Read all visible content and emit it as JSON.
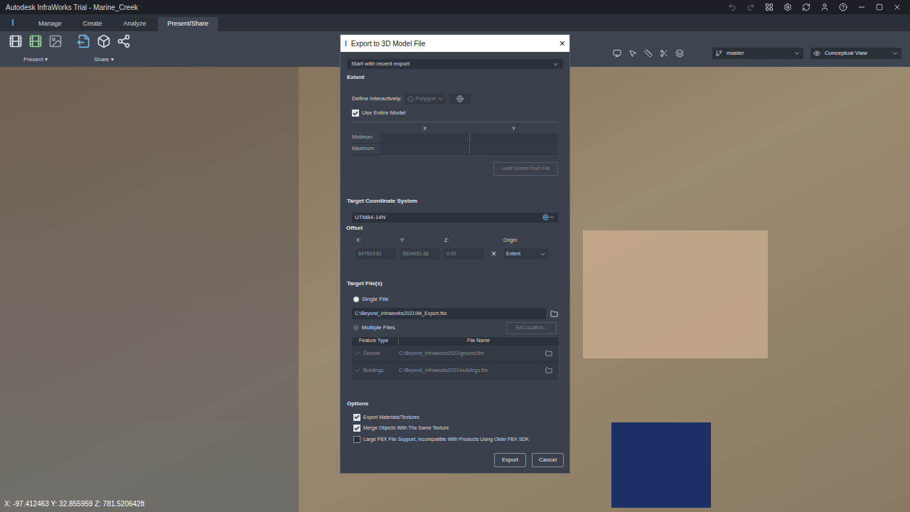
{
  "window": {
    "title": "Autodesk InfraWorks Trial - Marine_Creek",
    "logo": "I"
  },
  "ribbon": {
    "tabs": [
      {
        "label": "Manage",
        "selected": false
      },
      {
        "label": "Create",
        "selected": false
      },
      {
        "label": "Analyze",
        "selected": false
      },
      {
        "label": "Present/Share",
        "selected": true
      }
    ],
    "groups": [
      {
        "label": "Present",
        "arrow": "▾"
      },
      {
        "label": "Share",
        "arrow": "▾"
      }
    ],
    "branch": "master",
    "view": "Conceptual View"
  },
  "dialog": {
    "title": "Export to 3D Model File",
    "close": "×",
    "preset": "Start with recent export",
    "extent": {
      "heading": "Extent",
      "define_label": "Define Interactively:",
      "polygon": "Polygon",
      "polygon_disabled": true,
      "use_entire_model": {
        "label": "Use Entire Model",
        "checked": true
      },
      "columns": [
        "X",
        "Y"
      ],
      "rows": [
        "Minimum:",
        "Maximum:"
      ],
      "load_button": "Load Extent From File",
      "load_disabled": true
    },
    "coordinate_system": {
      "heading": "Target Coordinate System",
      "value": "UTM84-14N"
    },
    "offset": {
      "heading": "Offset",
      "fields": [
        {
          "label": "X:",
          "value": "647819.81"
        },
        {
          "label": "Y:",
          "value": "3634951.68"
        },
        {
          "label": "Z:",
          "value": "0.00"
        }
      ],
      "clear": "×",
      "origin_label": "Origin:",
      "origin": "Extent"
    },
    "target": {
      "heading": "Target File(s)",
      "modes": [
        {
          "label": "Single File",
          "selected": true
        },
        {
          "label": "Multiple Files",
          "selected": false
        }
      ],
      "path": "C:\\Beyond_Infraworks2021\\IM_Export.fbx",
      "set_location": "Set Location...",
      "columns": [
        "Feature Type",
        "File Name"
      ],
      "rows": [
        {
          "type": "Ground",
          "file": "C:\\Beyond_Infraworks2021\\ground.fbx",
          "checked": true
        },
        {
          "type": "Buildings",
          "file": "C:\\Beyond_Infraworks2021\\buildings.fbx",
          "checked": true
        }
      ]
    },
    "options": {
      "heading": "Options",
      "items": [
        {
          "label": "Export Materials/Textures",
          "checked": true
        },
        {
          "label": "Merge Objects With The Same Texture",
          "checked": true
        },
        {
          "label": "Large FBX File Support, Incompatible With Products Using Older FBX SDK",
          "checked": false
        }
      ]
    },
    "buttons": [
      "Export",
      "Cancel"
    ]
  },
  "status_bar": {
    "coordinates": "X: -97.412463 Y: 32.855959 Z: 781.520642ft"
  }
}
